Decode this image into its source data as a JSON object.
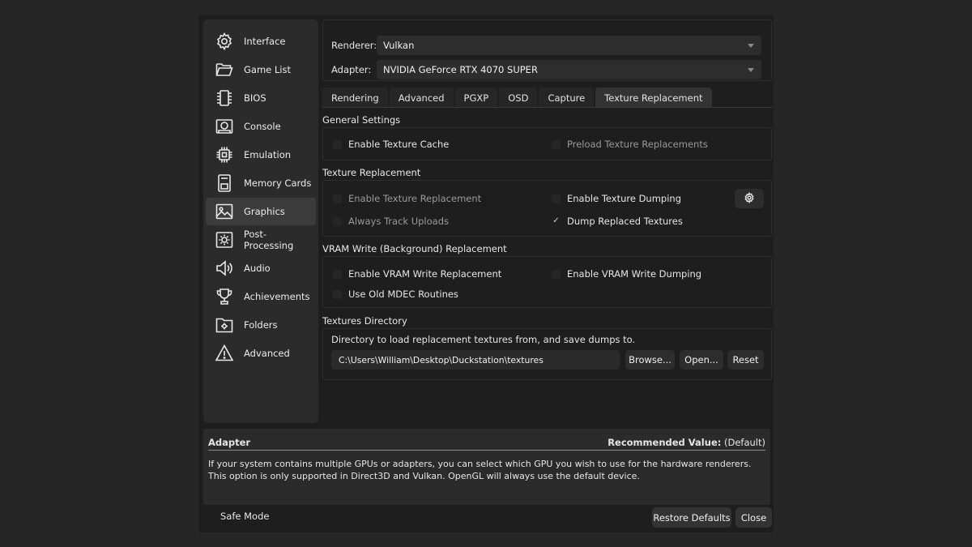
{
  "sidebar": {
    "items": [
      {
        "label": "Interface",
        "icon": "gear-icon"
      },
      {
        "label": "Game List",
        "icon": "folder-open-icon"
      },
      {
        "label": "BIOS",
        "icon": "chip-icon"
      },
      {
        "label": "Console",
        "icon": "console-icon"
      },
      {
        "label": "Emulation",
        "icon": "cpu-icon"
      },
      {
        "label": "Memory Cards",
        "icon": "memory-card-icon"
      },
      {
        "label": "Graphics",
        "icon": "image-icon"
      },
      {
        "label": "Post-Processing",
        "icon": "brightness-icon"
      },
      {
        "label": "Audio",
        "icon": "speaker-icon"
      },
      {
        "label": "Achievements",
        "icon": "trophy-icon"
      },
      {
        "label": "Folders",
        "icon": "folder-gear-icon"
      },
      {
        "label": "Advanced",
        "icon": "warning-icon"
      }
    ],
    "active": "Graphics"
  },
  "top": {
    "renderer_label": "Renderer:",
    "renderer_value": "Vulkan",
    "adapter_label": "Adapter:",
    "adapter_value": "NVIDIA GeForce RTX 4070 SUPER"
  },
  "tabs": [
    {
      "label": "Rendering"
    },
    {
      "label": "Advanced"
    },
    {
      "label": "PGXP"
    },
    {
      "label": "OSD"
    },
    {
      "label": "Capture"
    },
    {
      "label": "Texture Replacement"
    }
  ],
  "active_tab": "Texture Replacement",
  "general": {
    "title": "General Settings",
    "enable_texture_cache": {
      "label": "Enable Texture Cache",
      "checked": false
    },
    "preload_texture_replacements": {
      "label": "Preload Texture Replacements",
      "checked": false
    }
  },
  "texture_replacement": {
    "title": "Texture Replacement",
    "enable_texture_replacement": {
      "label": "Enable Texture Replacement",
      "checked": false
    },
    "enable_texture_dumping": {
      "label": "Enable Texture Dumping",
      "checked": false
    },
    "always_track_uploads": {
      "label": "Always Track Uploads",
      "checked": false
    },
    "dump_replaced_textures": {
      "label": "Dump Replaced Textures",
      "checked": true,
      "mark": "✓"
    }
  },
  "vram": {
    "title": "VRAM Write (Background) Replacement",
    "enable_vram_write_replacement": {
      "label": "Enable VRAM Write Replacement",
      "checked": false
    },
    "enable_vram_write_dumping": {
      "label": "Enable VRAM Write Dumping",
      "checked": false
    },
    "use_old_mdec_routines": {
      "label": "Use Old MDEC Routines",
      "checked": false
    }
  },
  "directory": {
    "title": "Textures Directory",
    "description": "Directory to load replacement textures from, and save dumps to.",
    "path": "C:\\Users\\William\\Desktop\\Duckstation\\textures",
    "browse_label": "Browse...",
    "open_label": "Open...",
    "reset_label": "Reset"
  },
  "info": {
    "title": "Adapter",
    "recommended_label": "Recommended Value:",
    "recommended_value": "(Default)",
    "line1": "If your system contains multiple GPUs or adapters, you can select which GPU you wish to use for the hardware renderers.",
    "line2": "This option is only supported in Direct3D and Vulkan. OpenGL will always use the default device."
  },
  "footer": {
    "safe_mode_label": "Safe Mode",
    "restore_defaults_label": "Restore Defaults",
    "close_label": "Close"
  }
}
